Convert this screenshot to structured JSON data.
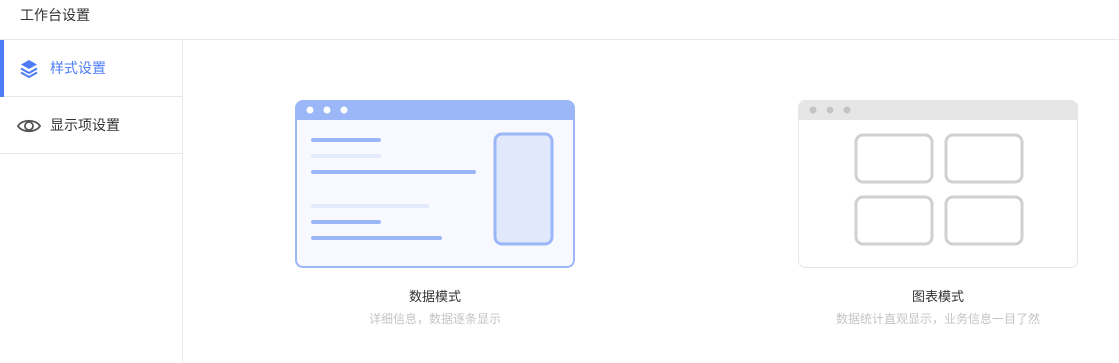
{
  "header": {
    "title": "工作台设置"
  },
  "sidebar": {
    "items": [
      {
        "label": "样式设置",
        "icon": "layers-icon",
        "active": true
      },
      {
        "label": "显示项设置",
        "icon": "eye-icon",
        "active": false
      }
    ]
  },
  "modes": [
    {
      "title": "数据模式",
      "description": "详细信息，数据逐条显示",
      "selected": true
    },
    {
      "title": "图表模式",
      "description": "数据统计直观显示，业务信息一目了然",
      "selected": false
    }
  ],
  "colors": {
    "accent": "#4d7cf5",
    "selected_header": "#9bb7f8",
    "selected_body": "#f7f9ff",
    "unselected_header": "#e6e6e6",
    "unselected_block": "#d0d0d0"
  }
}
